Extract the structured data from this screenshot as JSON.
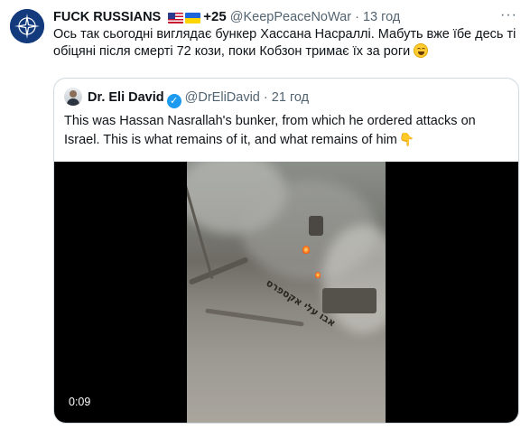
{
  "tweet": {
    "display_name": "FUCK RUSSIANS",
    "name_suffix": "+25",
    "handle": "@KeepPeaceNoWar",
    "separator": "·",
    "time": "13 год",
    "more_label": "···",
    "text": "Ось так сьогодні виглядає бункер Хассана Насраллі. Мабуть вже їбе десь ті обіцяні після смерті 72 кози, поки Кобзон тримає їх за роги",
    "avatar_icon": "nato-star-icon",
    "flag_icons": [
      "us-flag-icon",
      "ukraine-flag-icon"
    ],
    "emoji_icon": "tears-of-joy-emoji"
  },
  "quoted_tweet": {
    "display_name": "Dr. Eli David",
    "verified_icon": "verified-badge-icon",
    "handle": "@DrEliDavid",
    "separator": "·",
    "time": "21 год",
    "text": "This was Hassan Nasrallah's bunker, from which he ordered attacks on Israel. This is what remains of it, and what remains of him",
    "emoji_icon": "pointing-down-emoji",
    "video": {
      "overlay_text": "אבו עלי אקספרס",
      "duration": "0:09"
    }
  },
  "colors": {
    "text_primary": "#0f1419",
    "text_secondary": "#536471",
    "border": "#cfd9de",
    "verified": "#1d9bf0",
    "avatar_bg": "#123a7d"
  }
}
